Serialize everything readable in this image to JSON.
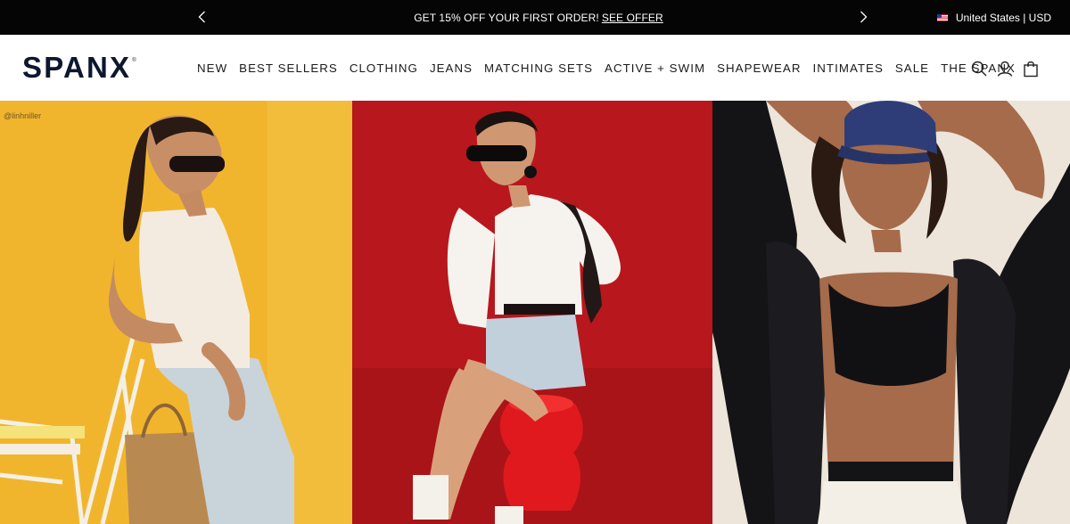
{
  "announcement": {
    "promo_text": "GET 15% OFF YOUR FIRST ORDER!",
    "offer_link": "SEE OFFER",
    "locale": "United States | USD",
    "prev_icon": "chevron-left-icon",
    "next_icon": "chevron-right-icon",
    "flag_icon": "us-flag-icon"
  },
  "header": {
    "logo": "SPANX",
    "logo_mark": "®",
    "nav": [
      {
        "label": "NEW"
      },
      {
        "label": "BEST SELLERS"
      },
      {
        "label": "CLOTHING"
      },
      {
        "label": "JEANS"
      },
      {
        "label": "MATCHING SETS"
      },
      {
        "label": "ACTIVE + SWIM"
      },
      {
        "label": "SHAPEWEAR"
      },
      {
        "label": "INTIMATES"
      },
      {
        "label": "SALE"
      },
      {
        "label": "THE SPANX"
      }
    ],
    "icons": [
      "search-icon",
      "account-icon",
      "bag-icon"
    ]
  },
  "hero": {
    "panels": [
      {
        "name": "yellow-lifestyle-photo",
        "handle": "@linhniller",
        "background": "#f1b52d"
      },
      {
        "name": "red-lifestyle-photo",
        "background": "#b8171d"
      },
      {
        "name": "neutral-active-photo",
        "background": "#ede4da"
      }
    ]
  },
  "colors": {
    "announcement_bg": "#050505",
    "logo": "#0d1730",
    "text": "#1a1a1a"
  }
}
